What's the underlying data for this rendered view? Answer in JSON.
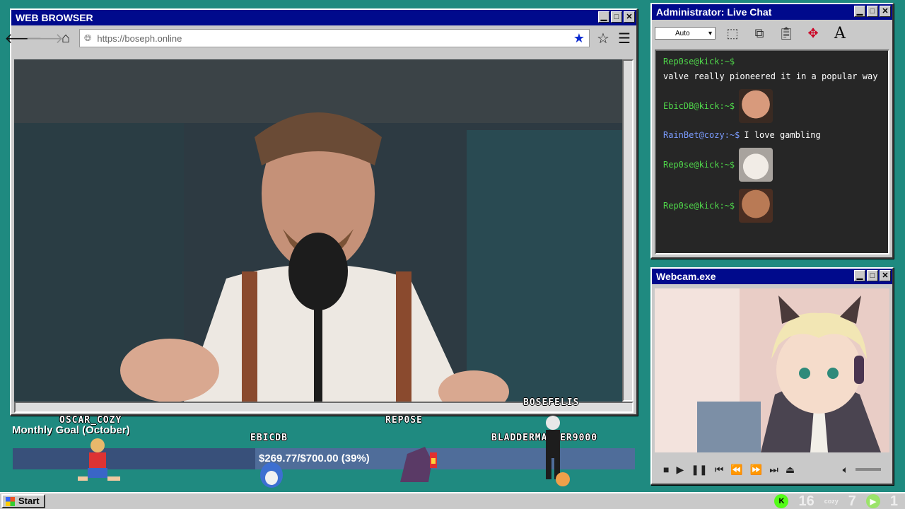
{
  "browser": {
    "title": "WEB BROWSER",
    "url": "https://boseph.online"
  },
  "chat": {
    "title": "Administrator: Live Chat",
    "font_select": "Auto",
    "messages": [
      {
        "user": "Rep0se@kick:~$",
        "text": "valve really pioneered it in a popular way"
      },
      {
        "user": "EbicDB@kick:~$",
        "text": ""
      },
      {
        "user": "RainBet@cozy:~$",
        "text": "I love gambling"
      },
      {
        "user": "Rep0se@kick:~$",
        "text": ""
      },
      {
        "user": "Rep0se@kick:~$",
        "text": ""
      }
    ]
  },
  "webcam": {
    "title": "Webcam.exe"
  },
  "goal": {
    "label": "Monthly Goal (October)",
    "amount": "$269.77/$700.00 (39%)",
    "progress": 0.39
  },
  "viewers": {
    "oscar": "OSCAR_COZY",
    "ebicdb": "EBICDB",
    "repose": "REP0SE",
    "bosefelis": "BOSEFELIS",
    "bladder": "BLADDERMASTER9000"
  },
  "taskbar": {
    "start": "Start",
    "count_a": "16",
    "cozy_label": "cozy",
    "count_b": "7",
    "count_c": "1"
  },
  "colors": {
    "desktop": "#1f8a80",
    "titlebar": "#000a8c",
    "chat_user": "#4fd64a",
    "chat_user_alt": "#7b9cff",
    "kick": "#53fc18"
  }
}
